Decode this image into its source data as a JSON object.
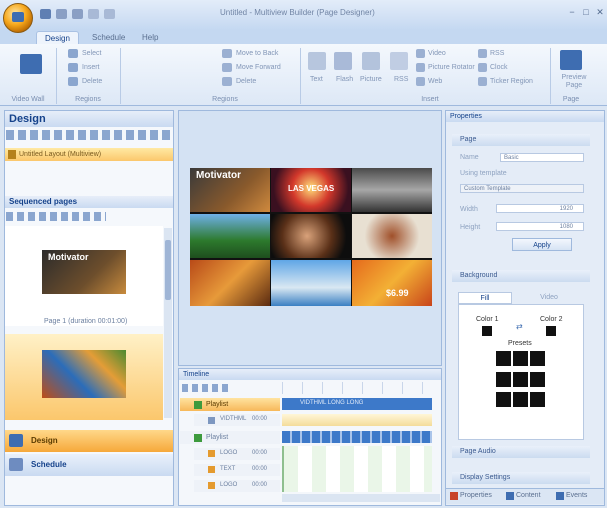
{
  "window": {
    "title": "Untitled - Multiview Builder (Page Designer)",
    "controls": [
      "−",
      "□",
      "✕"
    ]
  },
  "tabs": [
    "Design",
    "Schedule",
    "Help"
  ],
  "ribbon": {
    "groups": [
      {
        "label": "Video Wall",
        "items": [
          "Video Wall"
        ]
      },
      {
        "label": "Regions",
        "items": [
          "Select",
          "Insert",
          "Delete"
        ]
      },
      {
        "label": "Regions",
        "items": [
          "Move to Back",
          "Move Forward",
          "Delete"
        ]
      },
      {
        "label": "Insert",
        "items": [
          "Text",
          "Flash",
          "Picture",
          "RSS",
          "Video",
          "Picture Rotator",
          "Web",
          "RSS",
          "Clock",
          "Ticker Region"
        ]
      },
      {
        "label": "Page",
        "items": [
          "Preview Page"
        ]
      }
    ]
  },
  "left_panel": {
    "design_title": "Design",
    "design_item": "Untitled Layout (Multiview)",
    "sequenced_title": "Sequenced pages",
    "page1_caption": "Page 1 (duration 00:01:00)",
    "page1_logo": "Motivator",
    "nav": [
      {
        "label": "Design",
        "icon": "design-icon"
      },
      {
        "label": "Schedule",
        "icon": "schedule-icon"
      }
    ]
  },
  "canvas": {
    "logo_text": "Motivator",
    "sign_text": "LAS VEGAS",
    "price_text": "$6.99"
  },
  "timeline": {
    "title": "Timeline",
    "rows": [
      {
        "label": "Playlist",
        "time": ""
      },
      {
        "label": "VIDTHML",
        "time": "00:00"
      },
      {
        "label": "Playlist",
        "time": ""
      },
      {
        "label": "LOGO",
        "time": "00:00"
      },
      {
        "label": "TEXT",
        "time": "00:00"
      },
      {
        "label": "LOGO",
        "time": "00:00"
      }
    ],
    "bar_text": "VIDTHML LONG LONG"
  },
  "properties": {
    "title": "Properties",
    "page_section": "Page",
    "name_label": "Name",
    "name_value": "Basic",
    "using_template_label": "Using template",
    "template_value": "Custom Template",
    "width_label": "Width",
    "width_value": "1920",
    "height_label": "Height",
    "height_value": "1080",
    "apply_label": "Apply",
    "background_section": "Background",
    "bg_tabs": [
      "Fill",
      "Video"
    ],
    "color1_label": "Color 1",
    "color2_label": "Color 2",
    "presets_label": "Presets",
    "page_audio_section": "Page Audio",
    "display_section": "Display Settings",
    "bottom_tabs": [
      "Properties",
      "Content",
      "Events"
    ]
  },
  "colors": {
    "accent": "#15428b",
    "selection": "#fbc76c",
    "panel_border": "#9fb9dd"
  }
}
